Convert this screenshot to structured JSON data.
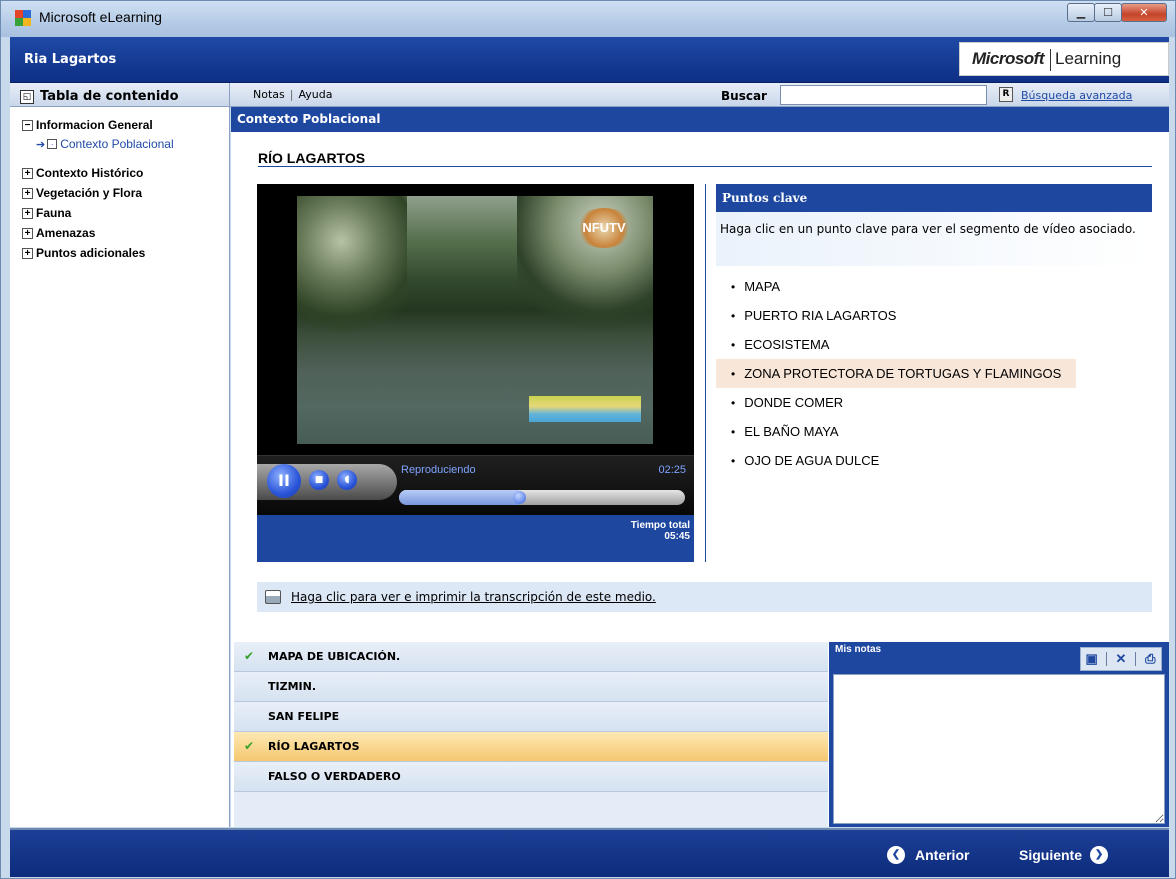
{
  "window": {
    "title": "Microsoft eLearning",
    "controls": [
      "minimize",
      "maximize",
      "close"
    ]
  },
  "header": {
    "course_title": "Ria Lagartos",
    "brand_bold": "Microsoft",
    "brand_light": "Learning"
  },
  "toolbar": {
    "toc_label": "Tabla de contenido",
    "notes_link": "Notas",
    "help_link": "Ayuda",
    "search_label": "Buscar",
    "search_value": "",
    "advanced_search": "Búsqueda avanzada"
  },
  "toc": {
    "items": [
      {
        "label": "Informacion General",
        "expanded": true
      },
      {
        "label": "Contexto Poblacional",
        "child": true,
        "current": true
      },
      {
        "label": "Contexto Histórico",
        "expanded": false
      },
      {
        "label": "Vegetación y Flora",
        "expanded": false
      },
      {
        "label": "Fauna",
        "expanded": false
      },
      {
        "label": "Amenazas",
        "expanded": false
      },
      {
        "label": "Puntos adicionales",
        "expanded": false
      }
    ]
  },
  "section": {
    "header": "Contexto Poblacional",
    "page_title": "RÍO LAGARTOS"
  },
  "video": {
    "overlay_logo": "NFUTV",
    "status": "Reproduciendo",
    "elapsed": "02:25",
    "total_label": "Tiempo total",
    "total": "05:45",
    "progress_fraction": 0.42
  },
  "key_points": {
    "header": "Puntos clave",
    "description": "Haga clic en un punto clave para ver el segmento de vídeo asociado.",
    "items": [
      "MAPA",
      "PUERTO RIA LAGARTOS",
      "ECOSISTEMA",
      "ZONA PROTECTORA DE TORTUGAS Y FLAMINGOS",
      "DONDE COMER",
      "EL BAÑO MAYA",
      "OJO DE AGUA DULCE"
    ],
    "highlighted_index": 3
  },
  "transcript": {
    "link": "Haga clic para ver e imprimir la transcripción de este medio."
  },
  "lessons": [
    {
      "label": "MAPA DE UBICACIÓN.",
      "checked": true
    },
    {
      "label": "TIZMIN.",
      "checked": false
    },
    {
      "label": "SAN FELIPE",
      "checked": false
    },
    {
      "label": "RÍO LAGARTOS",
      "checked": true,
      "active": true
    },
    {
      "label": "FALSO O VERDADERO",
      "checked": false
    }
  ],
  "notes": {
    "title": "Mis notas",
    "content": ""
  },
  "footer": {
    "prev": "Anterior",
    "next": "Siguiente"
  },
  "colors": {
    "accent": "#1e47a0",
    "active_lesson": "#f5c770",
    "highlight": "#f8e6d8",
    "check": "#36a02a"
  }
}
